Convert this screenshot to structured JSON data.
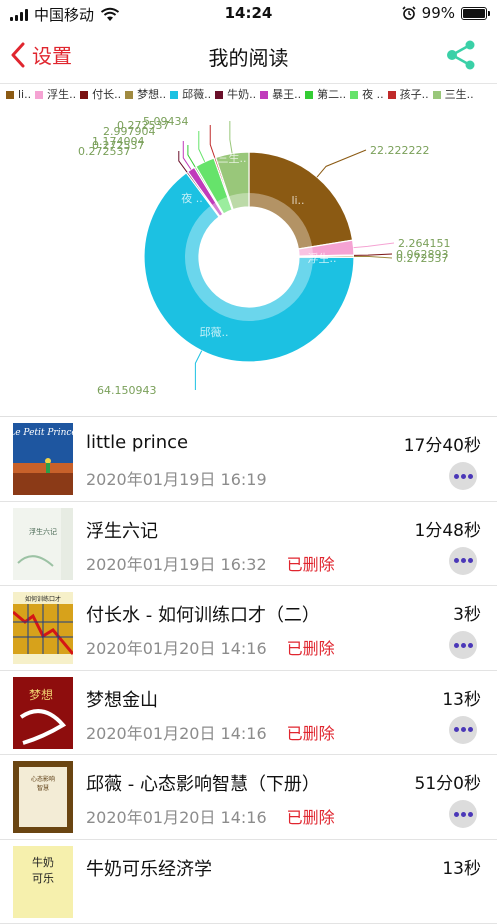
{
  "status_bar": {
    "carrier": "中国移动",
    "time": "14:24",
    "battery": "99%",
    "battery_level": 0.99
  },
  "nav": {
    "back_label": "设置",
    "title": "我的阅读"
  },
  "legend": [
    {
      "label": "li..",
      "color": "#8b5a13"
    },
    {
      "label": "浮生..",
      "color": "#f5a3d3"
    },
    {
      "label": "付长..",
      "color": "#7a1010"
    },
    {
      "label": "梦想..",
      "color": "#a08a40"
    },
    {
      "label": "邱薇..",
      "color": "#1cc1e2"
    },
    {
      "label": "牛奶..",
      "color": "#6a0f2a"
    },
    {
      "label": "暴王..",
      "color": "#c03bbb"
    },
    {
      "label": "第二..",
      "color": "#33cc33"
    },
    {
      "label": "夜 ..",
      "color": "#66e36b"
    },
    {
      "label": "孩子..",
      "color": "#c02a2a"
    },
    {
      "label": "三生..",
      "color": "#99c77a"
    }
  ],
  "chart_data": {
    "type": "pie",
    "donut": true,
    "title": "",
    "legend_position": "top",
    "slices": [
      {
        "label": "li..",
        "value": 22.222222,
        "value_label": "22.222222",
        "color": "#8b5a13"
      },
      {
        "label": "浮生..",
        "value": 2.264151,
        "value_label": "2.264151",
        "color": "#f5a3d3"
      },
      {
        "label": "付长..",
        "value": 0.062893,
        "value_label": "0.062893",
        "color": "#7a1010"
      },
      {
        "label": "梦想..",
        "value": 0.272537,
        "value_label": "0.272537",
        "color": "#a08a40"
      },
      {
        "label": "邱薇..",
        "value": 64.150943,
        "value_label": "64.150943",
        "color": "#1cc1e2"
      },
      {
        "label": "牛奶..",
        "value": 0.272537,
        "value_label": "0.272537",
        "color": "#6a0f2a"
      },
      {
        "label": "暴王..",
        "value": 1.174004,
        "value_label": "1.174004",
        "color": "#c03bbb"
      },
      {
        "label": "第二..",
        "value": 0.272537,
        "value_label": "0.272537",
        "color": "#33cc33"
      },
      {
        "label": "夜 ..",
        "value": 2.997904,
        "value_label": "2.997904",
        "color": "#66e36b"
      },
      {
        "label": "孩子..",
        "value": 0.272537,
        "value_label": "0.272537",
        "color": "#c02a2a"
      },
      {
        "label": "三生..",
        "value": 5.09434,
        "value_label": "5.09434",
        "color": "#99c77a"
      }
    ],
    "inner_labels": [
      "li..",
      "浮生..",
      "邱薇..",
      "三生..",
      "夜 .."
    ]
  },
  "books": [
    {
      "name": "little prince",
      "date": "2020年01月19日 16:19",
      "deleted": "",
      "duration": "17分40秒",
      "cover": "cover-little-prince"
    },
    {
      "name": "浮生六记",
      "date": "2020年01月19日 16:32",
      "deleted": "已删除",
      "duration": "1分48秒",
      "cover": "cover-fusheng"
    },
    {
      "name": "付长水 - 如何训练口才（二）",
      "date": "2020年01月20日 14:16",
      "deleted": "已删除",
      "duration": "3秒",
      "cover": "cover-fuchangshui"
    },
    {
      "name": "梦想金山",
      "date": "2020年01月20日 14:16",
      "deleted": "已删除",
      "duration": "13秒",
      "cover": "cover-mengxiang"
    },
    {
      "name": "邱薇 - 心态影响智慧（下册）",
      "date": "2020年01月20日 14:16",
      "deleted": "已删除",
      "duration": "51分0秒",
      "cover": "cover-qiuwei"
    },
    {
      "name": "牛奶可乐经济学",
      "date": "",
      "deleted": "",
      "duration": "13秒",
      "cover": "cover-niunai"
    }
  ],
  "icons": {
    "back": "chevron-left-icon",
    "share": "share-icon",
    "more": "more-dots-icon",
    "wifi": "wifi-icon",
    "alarm": "alarm-icon"
  }
}
